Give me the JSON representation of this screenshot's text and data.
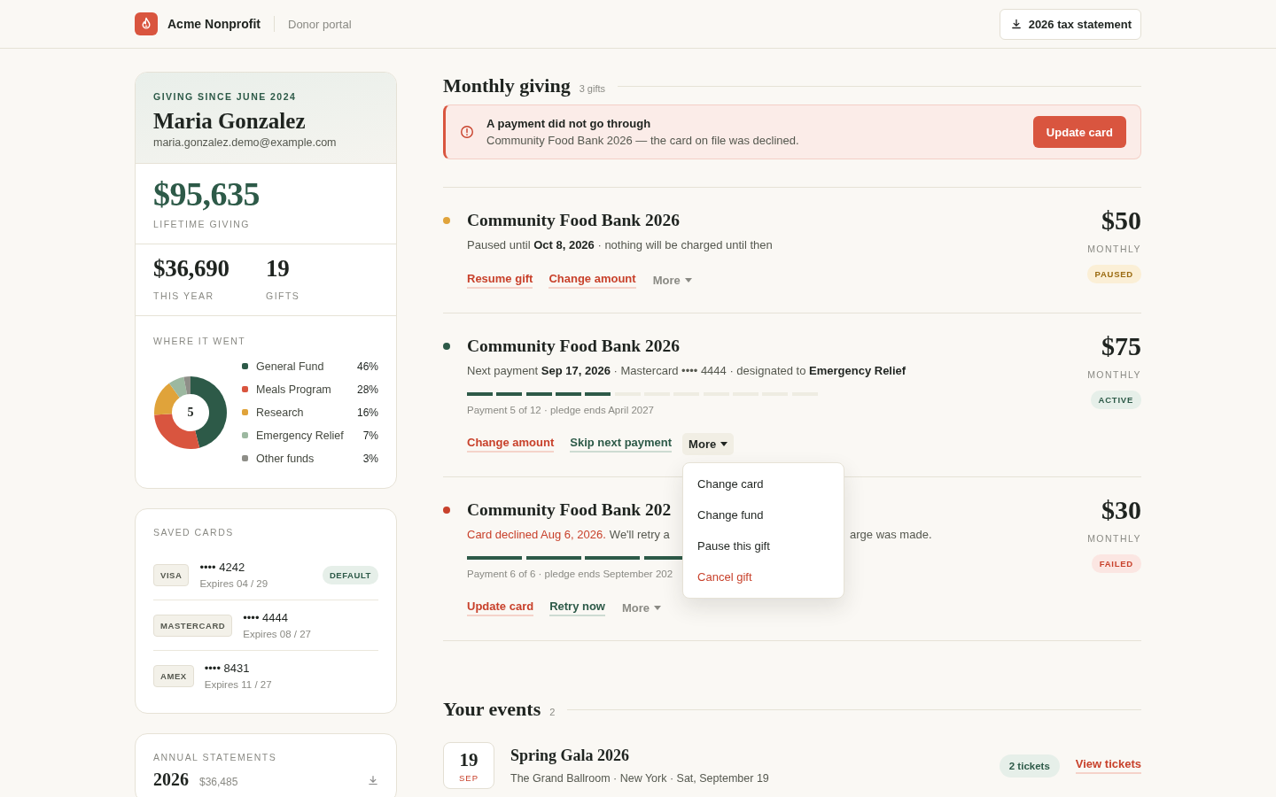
{
  "header": {
    "org": "Acme Nonprofit",
    "portal": "Donor portal",
    "tax_button": "2026 tax statement"
  },
  "profile": {
    "since": "GIVING SINCE JUNE 2024",
    "name": "Maria Gonzalez",
    "email": "maria.gonzalez.demo@example.com",
    "lifetime": "$95,635",
    "lifetime_label": "LIFETIME GIVING",
    "stats": [
      {
        "value": "$36,690",
        "label": "THIS YEAR"
      },
      {
        "value": "19",
        "label": "GIFTS"
      }
    ],
    "breakdown": {
      "title": "WHERE IT WENT",
      "center_label": "5",
      "chart_data": {
        "type": "donut",
        "categories": [
          "General Fund",
          "Meals Program",
          "Research",
          "Emergency Relief",
          "Other funds"
        ],
        "values": [
          46,
          28,
          16,
          7,
          3
        ],
        "colors": [
          "#2d5a48",
          "#d9553f",
          "#e0a33a",
          "#9cb8a0",
          "#8e8e88"
        ],
        "value_labels": [
          "46%",
          "28%",
          "16%",
          "7%",
          "3%"
        ]
      }
    }
  },
  "saved_cards": {
    "title": "SAVED CARDS",
    "cards": [
      {
        "brand": "VISA",
        "number": "•••• 4242",
        "expires": "Expires 04 / 29",
        "badge": "DEFAULT"
      },
      {
        "brand": "MASTERCARD",
        "number": "•••• 4444",
        "expires": "Expires 08 / 27"
      },
      {
        "brand": "AMEX",
        "number": "•••• 8431",
        "expires": "Expires 11 / 27"
      }
    ]
  },
  "statements": {
    "title": "ANNUAL STATEMENTS",
    "rows": [
      {
        "year": "2026",
        "amount": "$36,485"
      }
    ]
  },
  "monthly": {
    "title": "Monthly giving",
    "count": "3 gifts",
    "alert": {
      "title": "A payment did not go through",
      "text": "Community Food Bank 2026 — the card on file was declined.",
      "button": "Update card"
    },
    "gifts": [
      {
        "kind": "paused",
        "color": "#e0a33a",
        "title": "Community Food Bank 2026",
        "summary": "Paused until **Oct 8, 2026** · nothing will be charged until then",
        "amount": "$50",
        "period": "MONTHLY",
        "status": "PAUSED",
        "actions": [
          {
            "kind": "primary",
            "label": "Resume gift"
          },
          {
            "kind": "primary",
            "label": "Change amount"
          },
          {
            "kind": "more",
            "label": "More",
            "open": false
          }
        ]
      },
      {
        "kind": "active",
        "color": "#2d5a48",
        "title": "Community Food Bank 2026",
        "summary": "Next payment **Sep 17, 2026** · Mastercard •••• 4444 · designated to **Emergency Relief**",
        "progress": {
          "level": 0.4167,
          "note": "Payment 5 of 12 · pledge ends April 2027"
        },
        "amount": "$75",
        "period": "MONTHLY",
        "status": "ACTIVE",
        "actions": [
          {
            "kind": "primary",
            "label": "Change amount"
          },
          {
            "kind": "secondary",
            "label": "Skip next payment"
          },
          {
            "kind": "more",
            "label": "More",
            "open": true,
            "menu": [
              {
                "label": "Change card",
                "danger": false
              },
              {
                "label": "Change fund",
                "danger": false
              },
              {
                "label": "Pause this gift",
                "danger": false
              },
              {
                "label": "Cancel gift",
                "danger": true
              }
            ]
          }
        ]
      },
      {
        "kind": "failed",
        "color": "#c8412b",
        "title": "Community Food Bank 202",
        "alert": "Card declined Aug 6, 2026.",
        "summary": "We'll retry a",
        "summary_tail": "arge was made.",
        "progress": {
          "level": 1,
          "note": "Payment 6 of 6 · pledge ends September 202"
        },
        "amount": "$30",
        "period": "MONTHLY",
        "status": "FAILED",
        "actions": [
          {
            "kind": "primary",
            "label": "Update card"
          },
          {
            "kind": "secondary",
            "label": "Retry now"
          },
          {
            "kind": "more",
            "label": "More",
            "open": false
          }
        ]
      }
    ]
  },
  "events": {
    "title": "Your events",
    "count": "2",
    "items": [
      {
        "day": "19",
        "month": "SEP",
        "title": "Spring Gala 2026",
        "details": "The Grand Ballroom · New York · Sat, September 19",
        "tickets": "2 tickets",
        "link": "View tickets"
      }
    ]
  }
}
